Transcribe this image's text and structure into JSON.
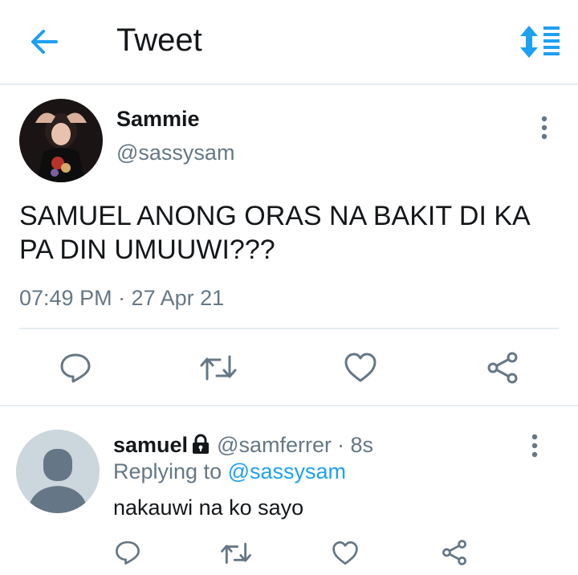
{
  "header": {
    "title": "Tweet",
    "back_icon": "arrow-left-icon",
    "sort_icon": "sort-list-icon",
    "accent": "#1da1f2"
  },
  "tweet": {
    "name": "Sammie",
    "handle": "@sassysam",
    "text": "SAMUEL ANONG ORAS NA BAKIT DI KA PA DIN UMUUWI???",
    "meta": "07:49 PM · 27 Apr 21",
    "actions": [
      "reply-icon",
      "retweet-icon",
      "like-icon",
      "share-icon"
    ]
  },
  "reply": {
    "name": "samuel",
    "handle": "@samferrer",
    "time": "· 8s",
    "replying_prefix": "Replying to ",
    "replying_to": "@sassysam",
    "text": "nakauwi na ko sayo",
    "protected_icon": "lock-icon",
    "actions": [
      "reply-icon",
      "retweet-icon",
      "like-icon",
      "share-icon"
    ]
  },
  "colors": {
    "text_primary": "#14171a",
    "text_secondary": "#657786",
    "divider": "#e6ecf0",
    "link": "#1da1f2"
  }
}
